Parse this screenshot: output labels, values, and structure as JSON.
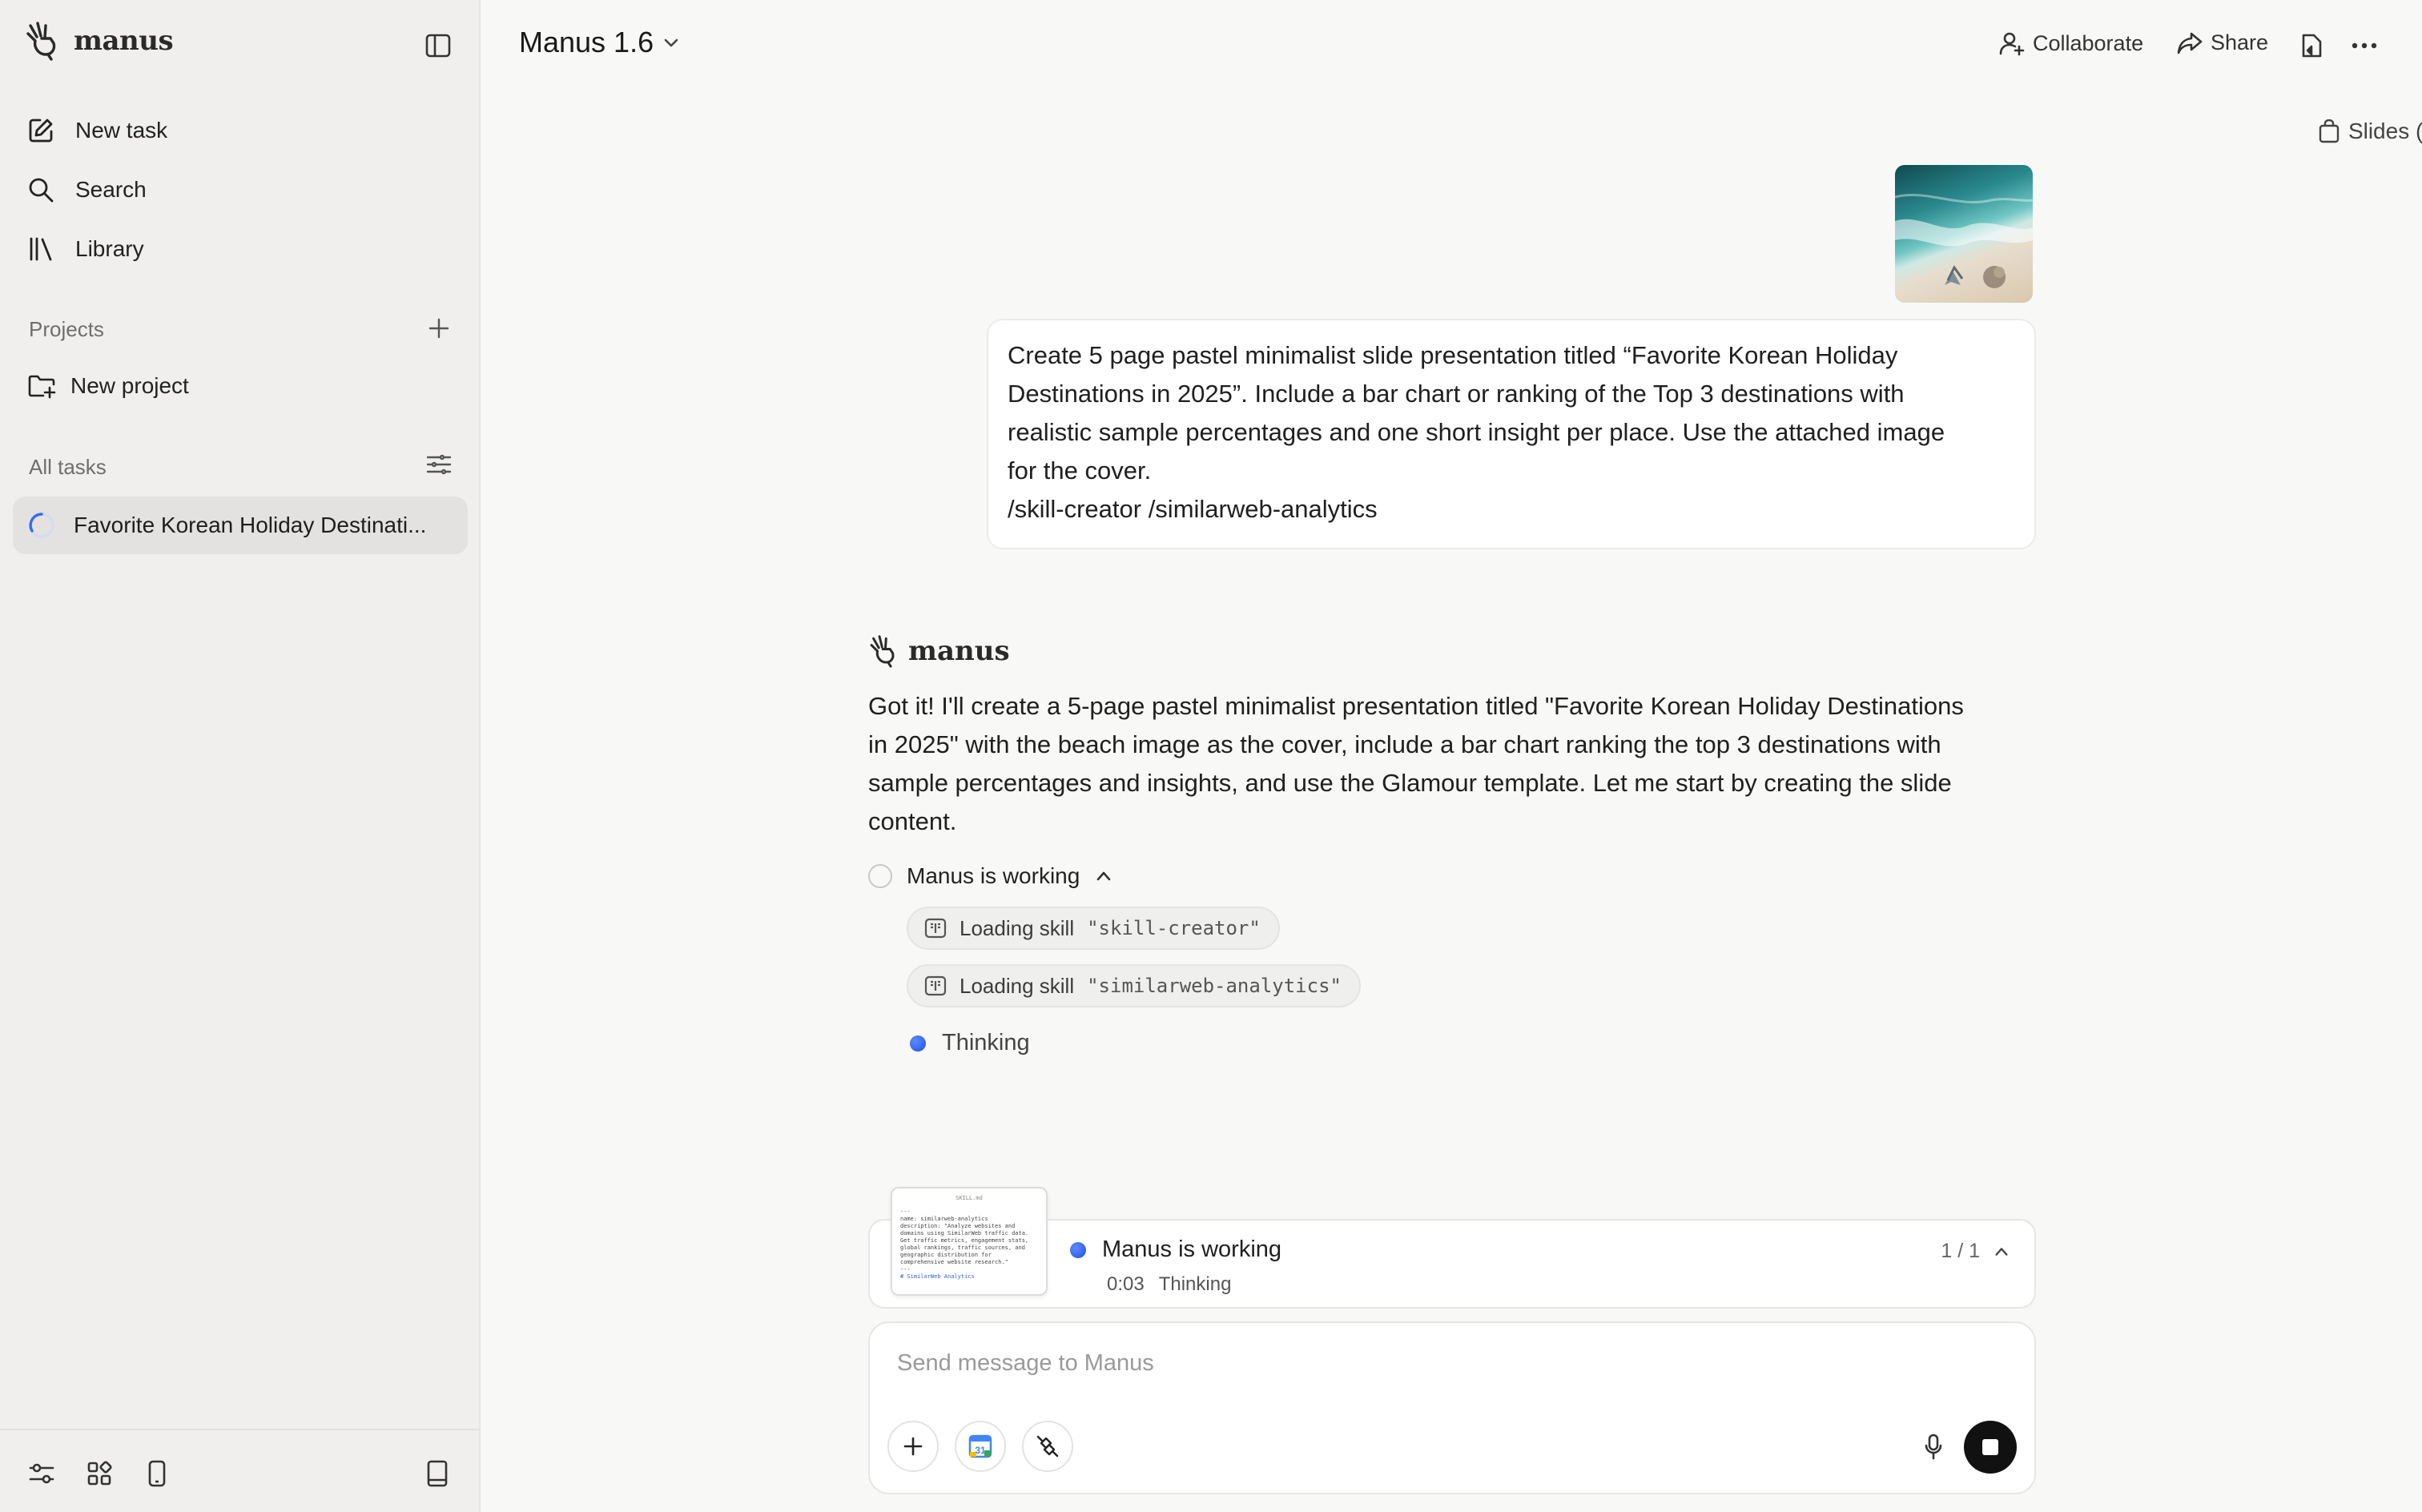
{
  "sidebar": {
    "brand": "manus",
    "nav": [
      {
        "label": "New task",
        "icon": "edit-icon"
      },
      {
        "label": "Search",
        "icon": "search-icon"
      },
      {
        "label": "Library",
        "icon": "library-icon"
      }
    ],
    "projects_label": "Projects",
    "new_project_label": "New project",
    "all_tasks_label": "All tasks",
    "tasks": [
      {
        "title": "Favorite Korean Holiday Destinati..."
      }
    ]
  },
  "header": {
    "model": "Manus 1.6",
    "collaborate_label": "Collaborate",
    "share_label": "Share"
  },
  "user_message": {
    "template_chip": "Slides (Glamour)",
    "lines": [
      "Create 5 page pastel minimalist slide presentation titled “Favorite Korean Holiday",
      "Destinations in 2025”. Include a bar chart or ranking of the Top 3 destinations with",
      "realistic sample percentages and one short insight per place. Use the attached image",
      "for the cover.",
      "/skill-creator /similarweb-analytics"
    ]
  },
  "assistant": {
    "name": "manus",
    "lines": [
      "Got it! I'll create a 5-page pastel minimalist presentation titled \"Favorite Korean Holiday Destinations",
      "in 2025\" with the beach image as the cover, include a bar chart ranking the top 3 destinations with",
      "sample percentages and insights, and use the Glamour template. Let me start by creating the slide",
      "content."
    ],
    "working_label": "Manus is working",
    "skills": [
      {
        "prefix": "Loading skill",
        "name": "\"skill-creator\""
      },
      {
        "prefix": "Loading skill",
        "name": "\"similarweb-analytics\""
      }
    ],
    "thinking_label": "Thinking"
  },
  "status_card": {
    "preview_title": "SKILL.md",
    "preview_lines": [
      "---",
      "name: similarweb-analytics",
      "description: \"Analyze websites and",
      "domains using SimilarWeb traffic data.",
      "Get traffic metrics, engagement stats,",
      "global rankings, traffic sources, and",
      "geographic distribution for",
      "comprehensive website research.\"",
      "---",
      "# SimilarWeb Analytics"
    ],
    "title": "Manus is working",
    "elapsed": "0:03",
    "status": "Thinking",
    "pager": "1 / 1"
  },
  "composer": {
    "placeholder": "Send message to Manus"
  },
  "colors": {
    "accent_blue": "#2f5ff0",
    "sidebar_bg": "#f0efee",
    "selected_task_bg": "#e3e2e0"
  }
}
